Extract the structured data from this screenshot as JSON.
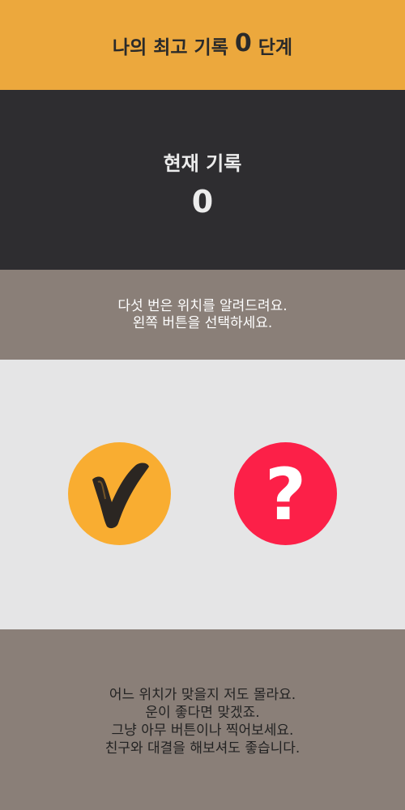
{
  "best_record": {
    "prefix": "나의 최고 기록",
    "value": "0",
    "suffix": "단계"
  },
  "current_record": {
    "label": "현재 기록",
    "value": "0"
  },
  "instruction": {
    "lines": [
      "다섯 번은 위치를 알려드려요.",
      "왼쪽 버튼을 선택하세요."
    ]
  },
  "buttons": {
    "check": {
      "icon": "checkmark-icon",
      "color": "#F9AD31"
    },
    "question": {
      "icon": "question-mark-icon",
      "symbol": "?",
      "color": "#FC2048"
    }
  },
  "hint": {
    "lines": [
      "어느 위치가 맞을지 저도 몰라요.",
      "운이 좋다면 맞겠죠.",
      "그냥 아무 버튼이나 찍어보세요.",
      "친구와 대결을 해보셔도 좋습니다."
    ]
  },
  "colors": {
    "header": "#ECA83D",
    "current_panel": "#2E2D30",
    "instruction_panel": "#8A7F78",
    "play_area": "#E5E5E6"
  }
}
